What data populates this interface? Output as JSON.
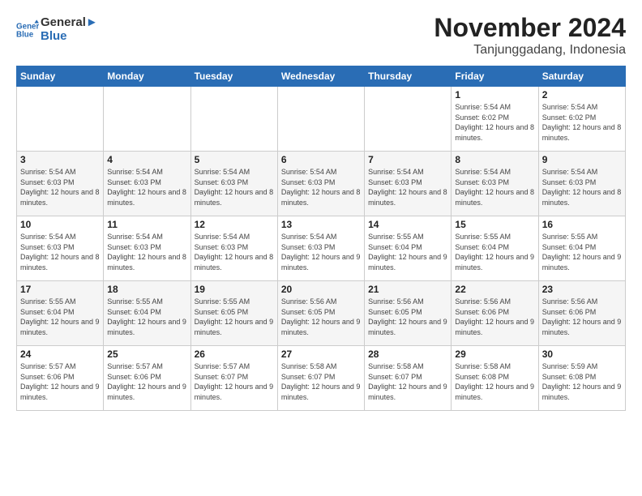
{
  "logo": {
    "line1": "General",
    "line2": "Blue"
  },
  "title": "November 2024",
  "location": "Tanjunggadang, Indonesia",
  "weekdays": [
    "Sunday",
    "Monday",
    "Tuesday",
    "Wednesday",
    "Thursday",
    "Friday",
    "Saturday"
  ],
  "weeks": [
    [
      {
        "day": "",
        "info": ""
      },
      {
        "day": "",
        "info": ""
      },
      {
        "day": "",
        "info": ""
      },
      {
        "day": "",
        "info": ""
      },
      {
        "day": "",
        "info": ""
      },
      {
        "day": "1",
        "info": "Sunrise: 5:54 AM\nSunset: 6:02 PM\nDaylight: 12 hours and 8 minutes."
      },
      {
        "day": "2",
        "info": "Sunrise: 5:54 AM\nSunset: 6:02 PM\nDaylight: 12 hours and 8 minutes."
      }
    ],
    [
      {
        "day": "3",
        "info": "Sunrise: 5:54 AM\nSunset: 6:03 PM\nDaylight: 12 hours and 8 minutes."
      },
      {
        "day": "4",
        "info": "Sunrise: 5:54 AM\nSunset: 6:03 PM\nDaylight: 12 hours and 8 minutes."
      },
      {
        "day": "5",
        "info": "Sunrise: 5:54 AM\nSunset: 6:03 PM\nDaylight: 12 hours and 8 minutes."
      },
      {
        "day": "6",
        "info": "Sunrise: 5:54 AM\nSunset: 6:03 PM\nDaylight: 12 hours and 8 minutes."
      },
      {
        "day": "7",
        "info": "Sunrise: 5:54 AM\nSunset: 6:03 PM\nDaylight: 12 hours and 8 minutes."
      },
      {
        "day": "8",
        "info": "Sunrise: 5:54 AM\nSunset: 6:03 PM\nDaylight: 12 hours and 8 minutes."
      },
      {
        "day": "9",
        "info": "Sunrise: 5:54 AM\nSunset: 6:03 PM\nDaylight: 12 hours and 8 minutes."
      }
    ],
    [
      {
        "day": "10",
        "info": "Sunrise: 5:54 AM\nSunset: 6:03 PM\nDaylight: 12 hours and 8 minutes."
      },
      {
        "day": "11",
        "info": "Sunrise: 5:54 AM\nSunset: 6:03 PM\nDaylight: 12 hours and 8 minutes."
      },
      {
        "day": "12",
        "info": "Sunrise: 5:54 AM\nSunset: 6:03 PM\nDaylight: 12 hours and 8 minutes."
      },
      {
        "day": "13",
        "info": "Sunrise: 5:54 AM\nSunset: 6:03 PM\nDaylight: 12 hours and 9 minutes."
      },
      {
        "day": "14",
        "info": "Sunrise: 5:55 AM\nSunset: 6:04 PM\nDaylight: 12 hours and 9 minutes."
      },
      {
        "day": "15",
        "info": "Sunrise: 5:55 AM\nSunset: 6:04 PM\nDaylight: 12 hours and 9 minutes."
      },
      {
        "day": "16",
        "info": "Sunrise: 5:55 AM\nSunset: 6:04 PM\nDaylight: 12 hours and 9 minutes."
      }
    ],
    [
      {
        "day": "17",
        "info": "Sunrise: 5:55 AM\nSunset: 6:04 PM\nDaylight: 12 hours and 9 minutes."
      },
      {
        "day": "18",
        "info": "Sunrise: 5:55 AM\nSunset: 6:04 PM\nDaylight: 12 hours and 9 minutes."
      },
      {
        "day": "19",
        "info": "Sunrise: 5:55 AM\nSunset: 6:05 PM\nDaylight: 12 hours and 9 minutes."
      },
      {
        "day": "20",
        "info": "Sunrise: 5:56 AM\nSunset: 6:05 PM\nDaylight: 12 hours and 9 minutes."
      },
      {
        "day": "21",
        "info": "Sunrise: 5:56 AM\nSunset: 6:05 PM\nDaylight: 12 hours and 9 minutes."
      },
      {
        "day": "22",
        "info": "Sunrise: 5:56 AM\nSunset: 6:06 PM\nDaylight: 12 hours and 9 minutes."
      },
      {
        "day": "23",
        "info": "Sunrise: 5:56 AM\nSunset: 6:06 PM\nDaylight: 12 hours and 9 minutes."
      }
    ],
    [
      {
        "day": "24",
        "info": "Sunrise: 5:57 AM\nSunset: 6:06 PM\nDaylight: 12 hours and 9 minutes."
      },
      {
        "day": "25",
        "info": "Sunrise: 5:57 AM\nSunset: 6:06 PM\nDaylight: 12 hours and 9 minutes."
      },
      {
        "day": "26",
        "info": "Sunrise: 5:57 AM\nSunset: 6:07 PM\nDaylight: 12 hours and 9 minutes."
      },
      {
        "day": "27",
        "info": "Sunrise: 5:58 AM\nSunset: 6:07 PM\nDaylight: 12 hours and 9 minutes."
      },
      {
        "day": "28",
        "info": "Sunrise: 5:58 AM\nSunset: 6:07 PM\nDaylight: 12 hours and 9 minutes."
      },
      {
        "day": "29",
        "info": "Sunrise: 5:58 AM\nSunset: 6:08 PM\nDaylight: 12 hours and 9 minutes."
      },
      {
        "day": "30",
        "info": "Sunrise: 5:59 AM\nSunset: 6:08 PM\nDaylight: 12 hours and 9 minutes."
      }
    ]
  ]
}
